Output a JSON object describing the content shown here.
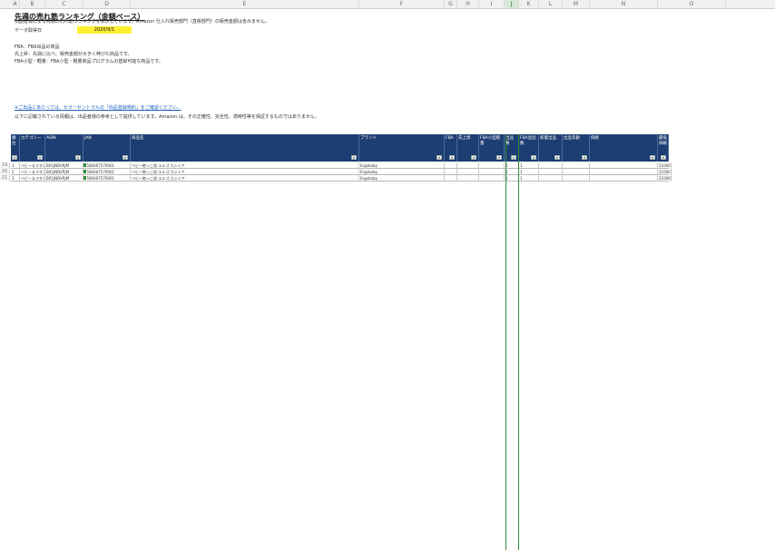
{
  "sheet": {
    "columns": [
      "A",
      "B",
      "C",
      "D",
      "E",
      "F",
      "G",
      "H",
      "I",
      "J",
      "K",
      "L",
      "M",
      "N",
      "O"
    ],
    "selected_column": "J",
    "title": "先週の売れ筋ランキング（金額ベース）",
    "date_label": "データ取得日",
    "date_value": "2020/9/1",
    "notes": [
      "出品者様による先週の売れ筋ランキングを表示しています。Amazon 仕入れ販売部門（直販部門）の販売金額は含みません。",
      "FBA：FBA出品の商品",
      "先上昇：先週に比べ、販売金額が大きく伸びた商品です。",
      "FBA小型・軽量：FBA小型・軽量商品プログラムの登録可能な商品です。"
    ],
    "link_text": "※ご出品にあたっては、セラーセントラルの「商品登録規約」をご確認ください。",
    "disclaimer": "以下に記載されている情報は、出品者様の参考として提供しています。Amazon は、その正確性、完全性、適時性等を保証するものではありません。"
  },
  "table": {
    "headers": [
      "順位",
      "カテゴリー",
      "ASIN",
      "JAN",
      "商品名",
      "ブランド",
      "FBA",
      "先上昇",
      "FBA小型軽量",
      "出品数",
      "FBA出品数",
      "新着出品",
      "出品年齢",
      "価格",
      "最低価格"
    ],
    "rows": [
      [
        "1",
        "ベビー＆マタニティ",
        "B01JNDVRJM",
        "4580467570001",
        "ベビー抱っこ紐 エルゴ カシミア",
        "Ergobaby",
        "",
        "",
        "",
        "1",
        "1",
        "",
        "",
        "",
        "21000"
      ],
      [
        "2",
        "ベビー＆マタニティ",
        "B01JNDVRJM",
        "4580467570001",
        "ベビー抱っこ紐 エルゴ カシミア",
        "Ergobaby",
        "",
        "",
        "",
        "1",
        "1",
        "",
        "",
        "",
        "21000"
      ],
      [
        "3",
        "ベビー＆マタニティ",
        "B01JNDVRJM",
        "4580467570001",
        "ベビー抱っこ紐 エルゴ カシミア",
        "Ergobaby",
        "",
        "",
        "",
        "1",
        "1",
        "",
        "",
        "",
        "21000"
      ]
    ],
    "row_numbers": [
      "19",
      "20",
      "21"
    ]
  }
}
